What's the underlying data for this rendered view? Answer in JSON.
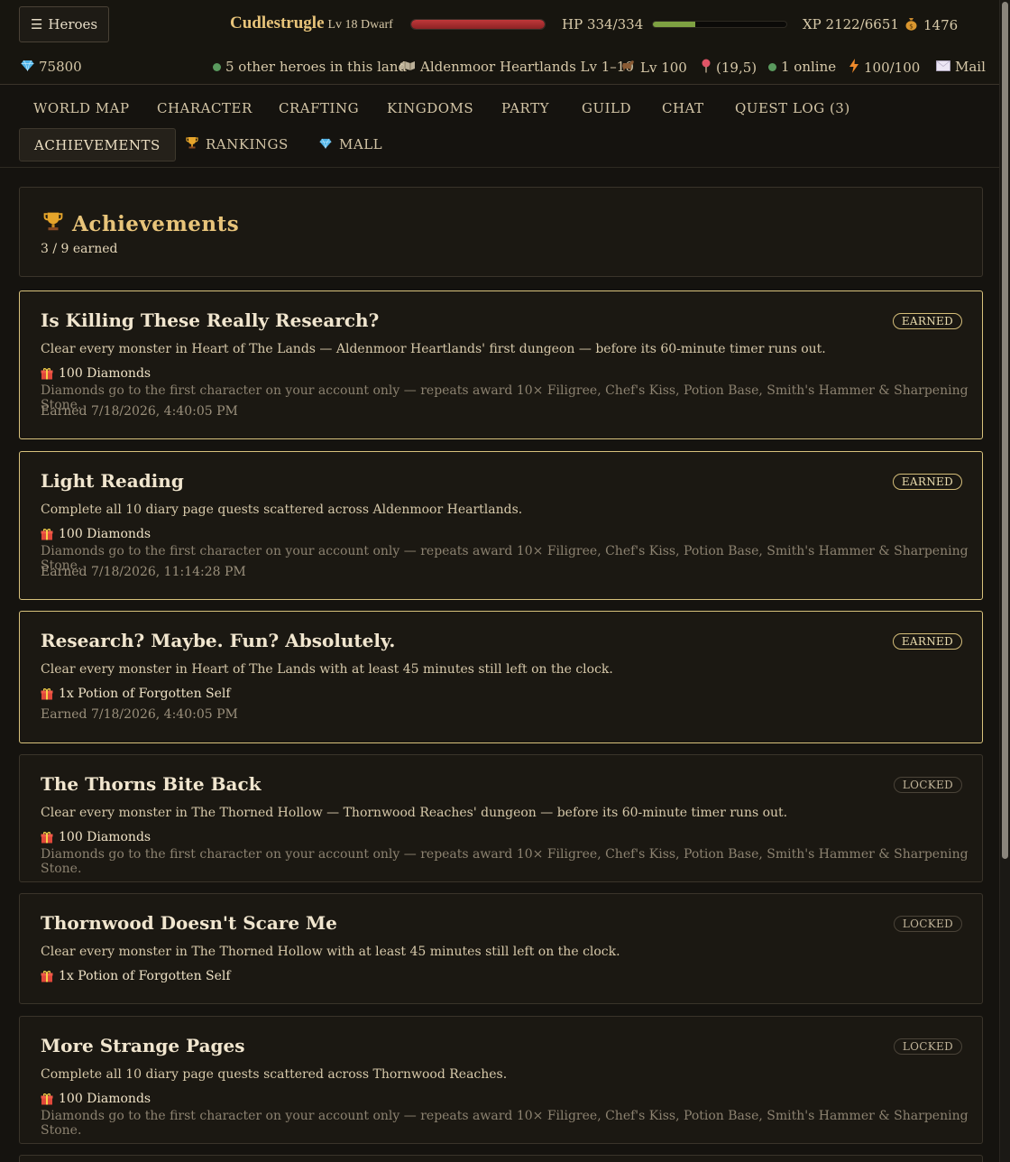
{
  "header": {
    "menu_button": "Heroes",
    "character": {
      "name": "Cudlestrugle",
      "level_class": "Lv 18 Dwarf"
    },
    "hp_text": "HP 334/334",
    "hp_fraction": 1.0,
    "xp_text": "XP 2122/6651",
    "xp_fraction": 0.319,
    "gold": "1476"
  },
  "status": {
    "diamonds": "75800",
    "heroes_nearby": "5 other heroes in this land",
    "land": "Aldenmoor Heartlands Lv 1–10",
    "mount_level": "Lv 100",
    "coords": "(19,5)",
    "online": "1 online",
    "energy": "100/100",
    "mail": "Mail"
  },
  "nav": {
    "tabs": [
      {
        "label": "WORLD MAP"
      },
      {
        "label": "CHARACTER"
      },
      {
        "label": "CRAFTING"
      },
      {
        "label": "KINGDOMS"
      },
      {
        "label": "PARTY"
      },
      {
        "label": "GUILD"
      },
      {
        "label": "CHAT"
      },
      {
        "label": "QUEST LOG (3)"
      },
      {
        "label": "ACHIEVEMENTS"
      },
      {
        "label": "RANKINGS"
      },
      {
        "label": "MALL"
      }
    ]
  },
  "achievements_header": {
    "title": "Achievements",
    "subtitle": "3 / 9 earned"
  },
  "achievements": [
    {
      "title": "Is Killing These Really Research?",
      "description": "Clear every monster in Heart of The Lands — Aldenmoor Heartlands' first dungeon — before its 60-minute timer runs out.",
      "reward": "100 Diamonds",
      "note": "Diamonds go to the first character on your account only — repeats award 10× Filigree, Chef's Kiss, Potion Base, Smith's Hammer & Sharpening Stone.",
      "earned_text": "Earned 7/18/2026, 4:40:05 PM",
      "status": "EARNED"
    },
    {
      "title": "Light Reading",
      "description": "Complete all 10 diary page quests scattered across Aldenmoor Heartlands.",
      "reward": "100 Diamonds",
      "note": "Diamonds go to the first character on your account only — repeats award 10× Filigree, Chef's Kiss, Potion Base, Smith's Hammer & Sharpening Stone.",
      "earned_text": "Earned 7/18/2026, 11:14:28 PM",
      "status": "EARNED"
    },
    {
      "title": "Research? Maybe. Fun? Absolutely.",
      "description": "Clear every monster in Heart of The Lands with at least 45 minutes still left on the clock.",
      "reward": "1x Potion of Forgotten Self",
      "note": "",
      "earned_text": "Earned 7/18/2026, 4:40:05 PM",
      "status": "EARNED"
    },
    {
      "title": "The Thorns Bite Back",
      "description": "Clear every monster in The Thorned Hollow — Thornwood Reaches' dungeon — before its 60-minute timer runs out.",
      "reward": "100 Diamonds",
      "note": "Diamonds go to the first character on your account only — repeats award 10× Filigree, Chef's Kiss, Potion Base, Smith's Hammer & Sharpening Stone.",
      "earned_text": "",
      "status": "LOCKED"
    },
    {
      "title": "Thornwood Doesn't Scare Me",
      "description": "Clear every monster in The Thorned Hollow with at least 45 minutes still left on the clock.",
      "reward": "1x Potion of Forgotten Self",
      "note": "",
      "earned_text": "",
      "status": "LOCKED"
    },
    {
      "title": "More Strange Pages",
      "description": "Complete all 10 diary page quests scattered across Thornwood Reaches.",
      "reward": "100 Diamonds",
      "note": "Diamonds go to the first character on your account only — repeats award 10× Filigree, Chef's Kiss, Potion Base, Smith's Hammer & Sharpening Stone.",
      "earned_text": "",
      "status": "LOCKED"
    }
  ],
  "colors": {
    "accent_gold": "#e8c47a",
    "hp_red": "#b3302f",
    "xp_green": "#7ea142",
    "earned_border": "#d8c27c"
  },
  "icons": {
    "menu": "hamburger-icon",
    "gold": "money-bag-icon",
    "diamond": "diamond-icon",
    "map": "map-icon",
    "mount": "horse-icon",
    "location": "pin-icon",
    "energy": "lightning-icon",
    "mail": "envelope-icon",
    "trophy": "trophy-icon",
    "gift": "gift-icon"
  }
}
